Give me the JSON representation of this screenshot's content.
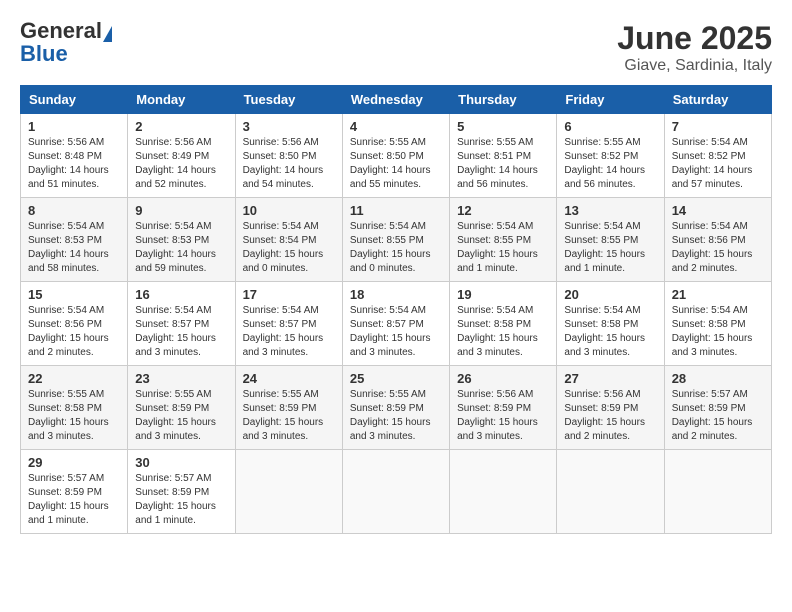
{
  "header": {
    "logo_general": "General",
    "logo_blue": "Blue",
    "title": "June 2025",
    "subtitle": "Giave, Sardinia, Italy"
  },
  "weekdays": [
    "Sunday",
    "Monday",
    "Tuesday",
    "Wednesday",
    "Thursday",
    "Friday",
    "Saturday"
  ],
  "weeks": [
    [
      {
        "day": "1",
        "info": "Sunrise: 5:56 AM\nSunset: 8:48 PM\nDaylight: 14 hours\nand 51 minutes."
      },
      {
        "day": "2",
        "info": "Sunrise: 5:56 AM\nSunset: 8:49 PM\nDaylight: 14 hours\nand 52 minutes."
      },
      {
        "day": "3",
        "info": "Sunrise: 5:56 AM\nSunset: 8:50 PM\nDaylight: 14 hours\nand 54 minutes."
      },
      {
        "day": "4",
        "info": "Sunrise: 5:55 AM\nSunset: 8:50 PM\nDaylight: 14 hours\nand 55 minutes."
      },
      {
        "day": "5",
        "info": "Sunrise: 5:55 AM\nSunset: 8:51 PM\nDaylight: 14 hours\nand 56 minutes."
      },
      {
        "day": "6",
        "info": "Sunrise: 5:55 AM\nSunset: 8:52 PM\nDaylight: 14 hours\nand 56 minutes."
      },
      {
        "day": "7",
        "info": "Sunrise: 5:54 AM\nSunset: 8:52 PM\nDaylight: 14 hours\nand 57 minutes."
      }
    ],
    [
      {
        "day": "8",
        "info": "Sunrise: 5:54 AM\nSunset: 8:53 PM\nDaylight: 14 hours\nand 58 minutes."
      },
      {
        "day": "9",
        "info": "Sunrise: 5:54 AM\nSunset: 8:53 PM\nDaylight: 14 hours\nand 59 minutes."
      },
      {
        "day": "10",
        "info": "Sunrise: 5:54 AM\nSunset: 8:54 PM\nDaylight: 15 hours\nand 0 minutes."
      },
      {
        "day": "11",
        "info": "Sunrise: 5:54 AM\nSunset: 8:55 PM\nDaylight: 15 hours\nand 0 minutes."
      },
      {
        "day": "12",
        "info": "Sunrise: 5:54 AM\nSunset: 8:55 PM\nDaylight: 15 hours\nand 1 minute."
      },
      {
        "day": "13",
        "info": "Sunrise: 5:54 AM\nSunset: 8:55 PM\nDaylight: 15 hours\nand 1 minute."
      },
      {
        "day": "14",
        "info": "Sunrise: 5:54 AM\nSunset: 8:56 PM\nDaylight: 15 hours\nand 2 minutes."
      }
    ],
    [
      {
        "day": "15",
        "info": "Sunrise: 5:54 AM\nSunset: 8:56 PM\nDaylight: 15 hours\nand 2 minutes."
      },
      {
        "day": "16",
        "info": "Sunrise: 5:54 AM\nSunset: 8:57 PM\nDaylight: 15 hours\nand 3 minutes."
      },
      {
        "day": "17",
        "info": "Sunrise: 5:54 AM\nSunset: 8:57 PM\nDaylight: 15 hours\nand 3 minutes."
      },
      {
        "day": "18",
        "info": "Sunrise: 5:54 AM\nSunset: 8:57 PM\nDaylight: 15 hours\nand 3 minutes."
      },
      {
        "day": "19",
        "info": "Sunrise: 5:54 AM\nSunset: 8:58 PM\nDaylight: 15 hours\nand 3 minutes."
      },
      {
        "day": "20",
        "info": "Sunrise: 5:54 AM\nSunset: 8:58 PM\nDaylight: 15 hours\nand 3 minutes."
      },
      {
        "day": "21",
        "info": "Sunrise: 5:54 AM\nSunset: 8:58 PM\nDaylight: 15 hours\nand 3 minutes."
      }
    ],
    [
      {
        "day": "22",
        "info": "Sunrise: 5:55 AM\nSunset: 8:58 PM\nDaylight: 15 hours\nand 3 minutes."
      },
      {
        "day": "23",
        "info": "Sunrise: 5:55 AM\nSunset: 8:59 PM\nDaylight: 15 hours\nand 3 minutes."
      },
      {
        "day": "24",
        "info": "Sunrise: 5:55 AM\nSunset: 8:59 PM\nDaylight: 15 hours\nand 3 minutes."
      },
      {
        "day": "25",
        "info": "Sunrise: 5:55 AM\nSunset: 8:59 PM\nDaylight: 15 hours\nand 3 minutes."
      },
      {
        "day": "26",
        "info": "Sunrise: 5:56 AM\nSunset: 8:59 PM\nDaylight: 15 hours\nand 3 minutes."
      },
      {
        "day": "27",
        "info": "Sunrise: 5:56 AM\nSunset: 8:59 PM\nDaylight: 15 hours\nand 2 minutes."
      },
      {
        "day": "28",
        "info": "Sunrise: 5:57 AM\nSunset: 8:59 PM\nDaylight: 15 hours\nand 2 minutes."
      }
    ],
    [
      {
        "day": "29",
        "info": "Sunrise: 5:57 AM\nSunset: 8:59 PM\nDaylight: 15 hours\nand 1 minute."
      },
      {
        "day": "30",
        "info": "Sunrise: 5:57 AM\nSunset: 8:59 PM\nDaylight: 15 hours\nand 1 minute."
      },
      {
        "day": "",
        "info": ""
      },
      {
        "day": "",
        "info": ""
      },
      {
        "day": "",
        "info": ""
      },
      {
        "day": "",
        "info": ""
      },
      {
        "day": "",
        "info": ""
      }
    ]
  ]
}
